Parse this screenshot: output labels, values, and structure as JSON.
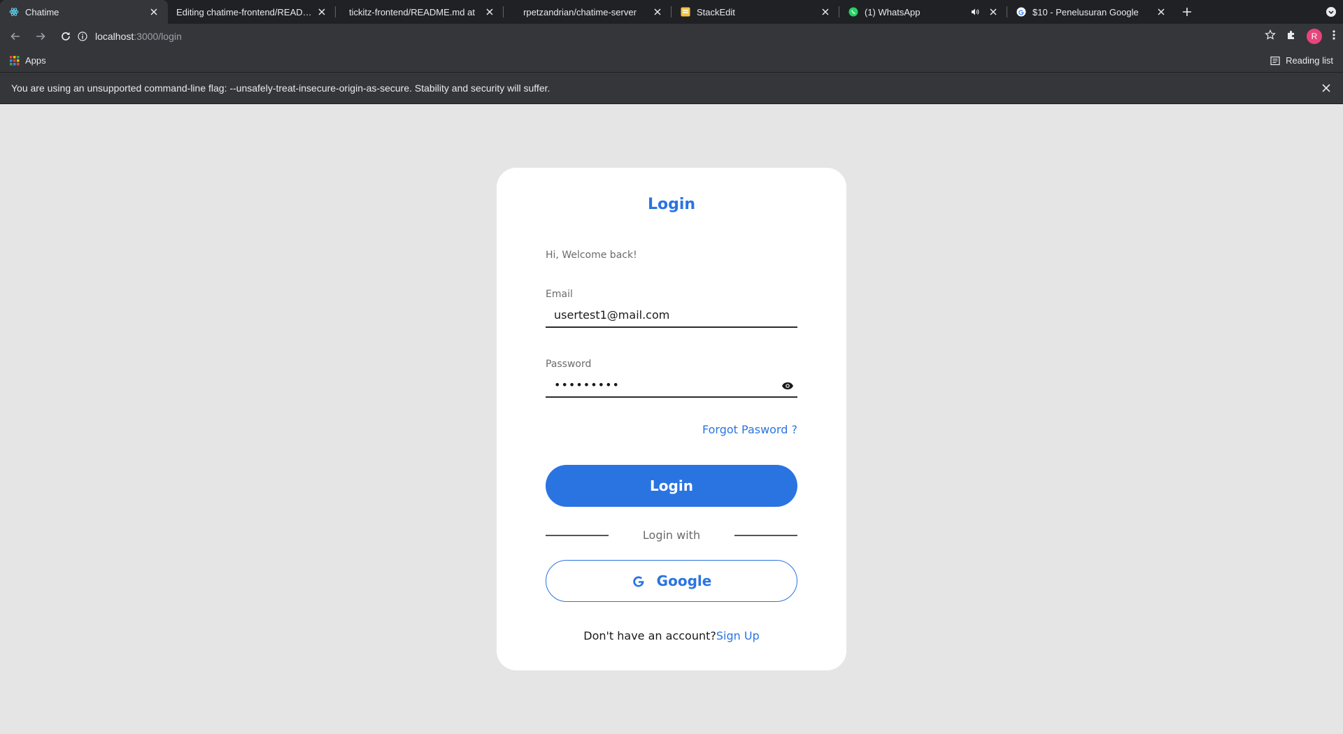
{
  "browser": {
    "tabs": [
      {
        "title": "Chatime",
        "icon": "react-icon",
        "active": true
      },
      {
        "title": "Editing chatime-frontend/README",
        "icon": "",
        "active": false
      },
      {
        "title": "tickitz-frontend/README.md at",
        "icon": "",
        "active": false
      },
      {
        "title": "rpetzandrian/chatime-server",
        "icon": "",
        "active": false
      },
      {
        "title": "StackEdit",
        "icon": "stackedit-icon",
        "active": false
      },
      {
        "title": "(1) WhatsApp",
        "icon": "whatsapp-icon",
        "active": false
      },
      {
        "title": "$10 - Penelusuran Google",
        "icon": "google-icon",
        "active": false
      }
    ],
    "url_host": "localhost",
    "url_path": ":3000/login",
    "avatar_letter": "R",
    "bookmarks": {
      "apps_label": "Apps",
      "reading_list_label": "Reading list"
    },
    "infobar_text": "You are using an unsupported command-line flag: --unsafely-treat-insecure-origin-as-secure. Stability and security will suffer."
  },
  "login": {
    "title": "Login",
    "welcome": "Hi, Welcome back!",
    "email_label": "Email",
    "email_value": "usertest1@mail.com",
    "password_label": "Password",
    "password_value": "•••••••••",
    "forgot_label": "Forgot Pasword ?",
    "login_button": "Login",
    "divider_text": "Login with",
    "google_button": "Google",
    "signup_prompt": "Don't have an account?",
    "signup_link": "Sign Up"
  },
  "colors": {
    "accent": "#2a74e2",
    "page_bg": "#e5e5e5",
    "chrome_dark": "#202124",
    "chrome": "#35363a"
  }
}
